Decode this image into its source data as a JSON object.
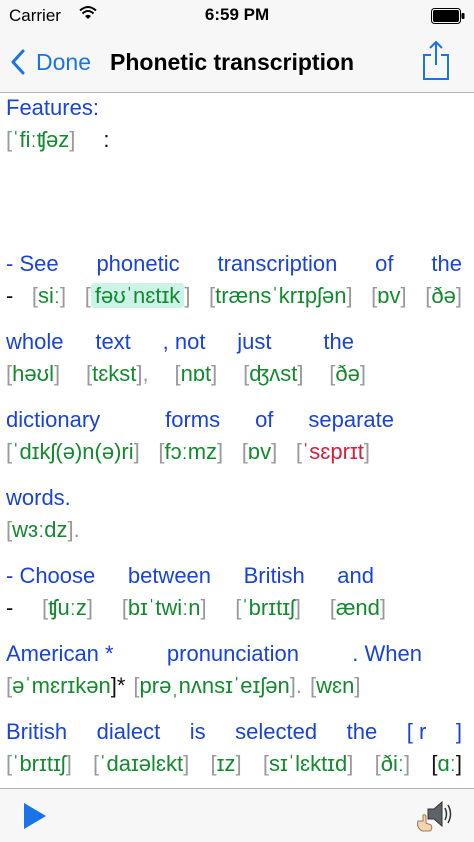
{
  "status_bar": {
    "carrier": "Carrier",
    "time": "6:59 PM"
  },
  "nav": {
    "back_label": "Done",
    "title": "Phonetic transcription"
  },
  "colors": {
    "accent": "#1a73e8",
    "english": "#1a43d8",
    "ipa": "#148a2e",
    "ipa_error": "#d4213b",
    "highlight": "#cdf3e8"
  },
  "lines": [
    {
      "eng": [
        "Features:"
      ],
      "ipa": [
        [
          "[",
          "ˈfiːʧəz",
          "]"
        ],
        [
          ":"
        ]
      ]
    },
    {
      "eng": [
        "- See",
        "phonetic",
        "transcription",
        "of",
        "the"
      ],
      "ipa": [
        [
          "-"
        ],
        [
          "[",
          "siː",
          "]"
        ],
        [
          "[",
          "fəʊˈnɛtɪk",
          "]"
        ],
        [
          "[",
          "trænsˈkrɪpʃən",
          "]"
        ],
        [
          "[",
          "ɒv",
          "]"
        ],
        [
          "[",
          "ðə",
          "]"
        ]
      ]
    },
    {
      "eng": [
        "whole",
        "text",
        ", not",
        "just",
        "the"
      ],
      "ipa": [
        [
          "[",
          "həʊl",
          "]"
        ],
        [
          "[",
          "tɛkst",
          "],"
        ],
        [
          "[",
          "nɒt",
          "]"
        ],
        [
          "[",
          "ʤʌst",
          "]"
        ],
        [
          "[",
          "ðə",
          "]"
        ]
      ]
    },
    {
      "eng": [
        "dictionary",
        "forms",
        "of",
        "separate"
      ],
      "ipa": [
        [
          "[",
          "ˈdɪkʃ(ə)n(ə)ri",
          "]"
        ],
        [
          "[",
          "fɔːmz",
          "]"
        ],
        [
          "[",
          "ɒv",
          "]"
        ],
        [
          "[",
          "ˈsɛprɪt",
          "]"
        ]
      ]
    },
    {
      "eng": [
        "words."
      ],
      "ipa": [
        [
          "[",
          "wɜːdz",
          "]."
        ]
      ]
    },
    {
      "eng": [
        "- Choose",
        "between",
        "British",
        "and"
      ],
      "ipa": [
        [
          "-"
        ],
        [
          "[",
          "ʧuːz",
          "]"
        ],
        [
          "[",
          "bɪˈtwiːn",
          "]"
        ],
        [
          "[",
          "ˈbrɪtɪʃ",
          "]"
        ],
        [
          "[",
          "ænd",
          "]"
        ]
      ]
    },
    {
      "eng": [
        "American *",
        "pronunciation",
        ". When"
      ],
      "ipa": [
        [
          "[",
          "əˈmɛrɪkən",
          "]*"
        ],
        [
          "[",
          "prəˌnʌnsɪˈeɪʃən",
          "]."
        ],
        [
          "[",
          "wɛn",
          "]"
        ]
      ]
    },
    {
      "eng": [
        "British",
        "dialect",
        "is",
        "selected",
        "the",
        "[ r",
        "]"
      ],
      "ipa": [
        [
          "[",
          "ˈbrɪtɪʃ",
          "]"
        ],
        [
          "[",
          "ˈdaɪəlɛkt",
          "]"
        ],
        [
          "[",
          "ɪz",
          "]"
        ],
        [
          "[",
          "sɪˈlɛktɪd",
          "]"
        ],
        [
          "[",
          "ðiː",
          "]"
        ],
        [
          "[",
          "ɑː",
          "]"
        ]
      ]
    }
  ],
  "toolbar": {
    "play_icon": "play-icon",
    "speaker_icon": "speaker-icon"
  }
}
